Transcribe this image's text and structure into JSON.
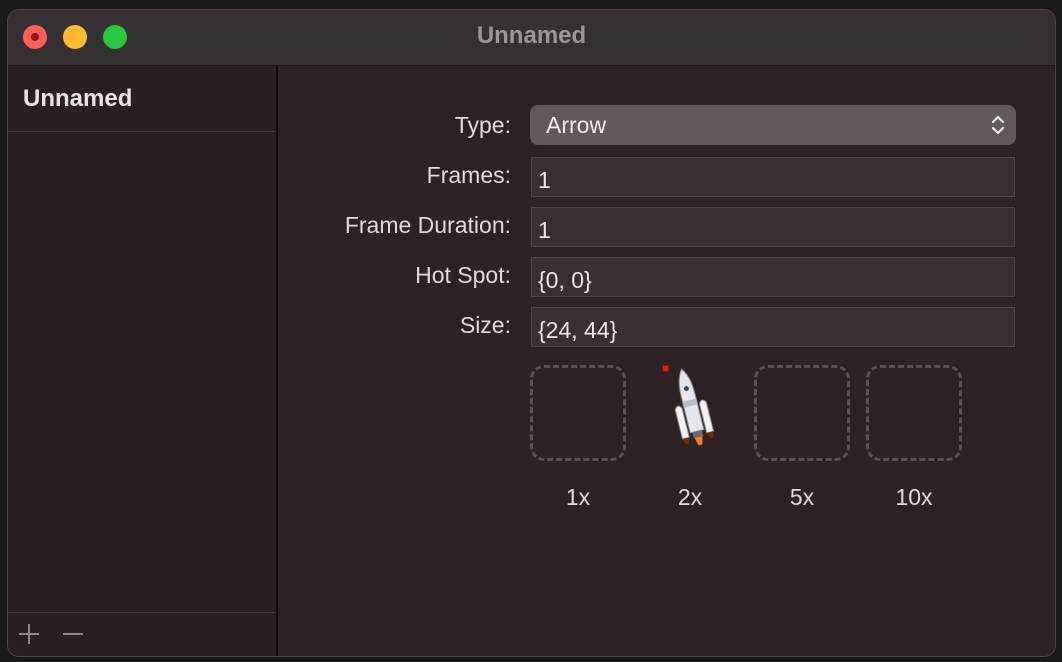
{
  "window": {
    "title": "Unnamed"
  },
  "sidebar": {
    "items": [
      {
        "label": "Unnamed"
      }
    ],
    "footer": {
      "add_icon": "plus-icon",
      "remove_icon": "minus-icon"
    }
  },
  "form": {
    "type": {
      "label": "Type:",
      "value": "Arrow"
    },
    "frames": {
      "label": "Frames:",
      "value": "1"
    },
    "frame_duration": {
      "label": "Frame Duration:",
      "value": "1"
    },
    "hot_spot": {
      "label": "Hot Spot:",
      "value": "{0, 0}"
    },
    "size": {
      "label": "Size:",
      "value": "{24, 44}"
    }
  },
  "image_wells": [
    {
      "label": "1x"
    },
    {
      "label": "2x",
      "icon": "rocket-icon"
    },
    {
      "label": "5x"
    },
    {
      "label": "10x"
    }
  ],
  "colors": {
    "close": "#ff5f57",
    "minimize": "#febc2e",
    "zoom": "#28c840",
    "hotspot_marker": "#e02020"
  }
}
